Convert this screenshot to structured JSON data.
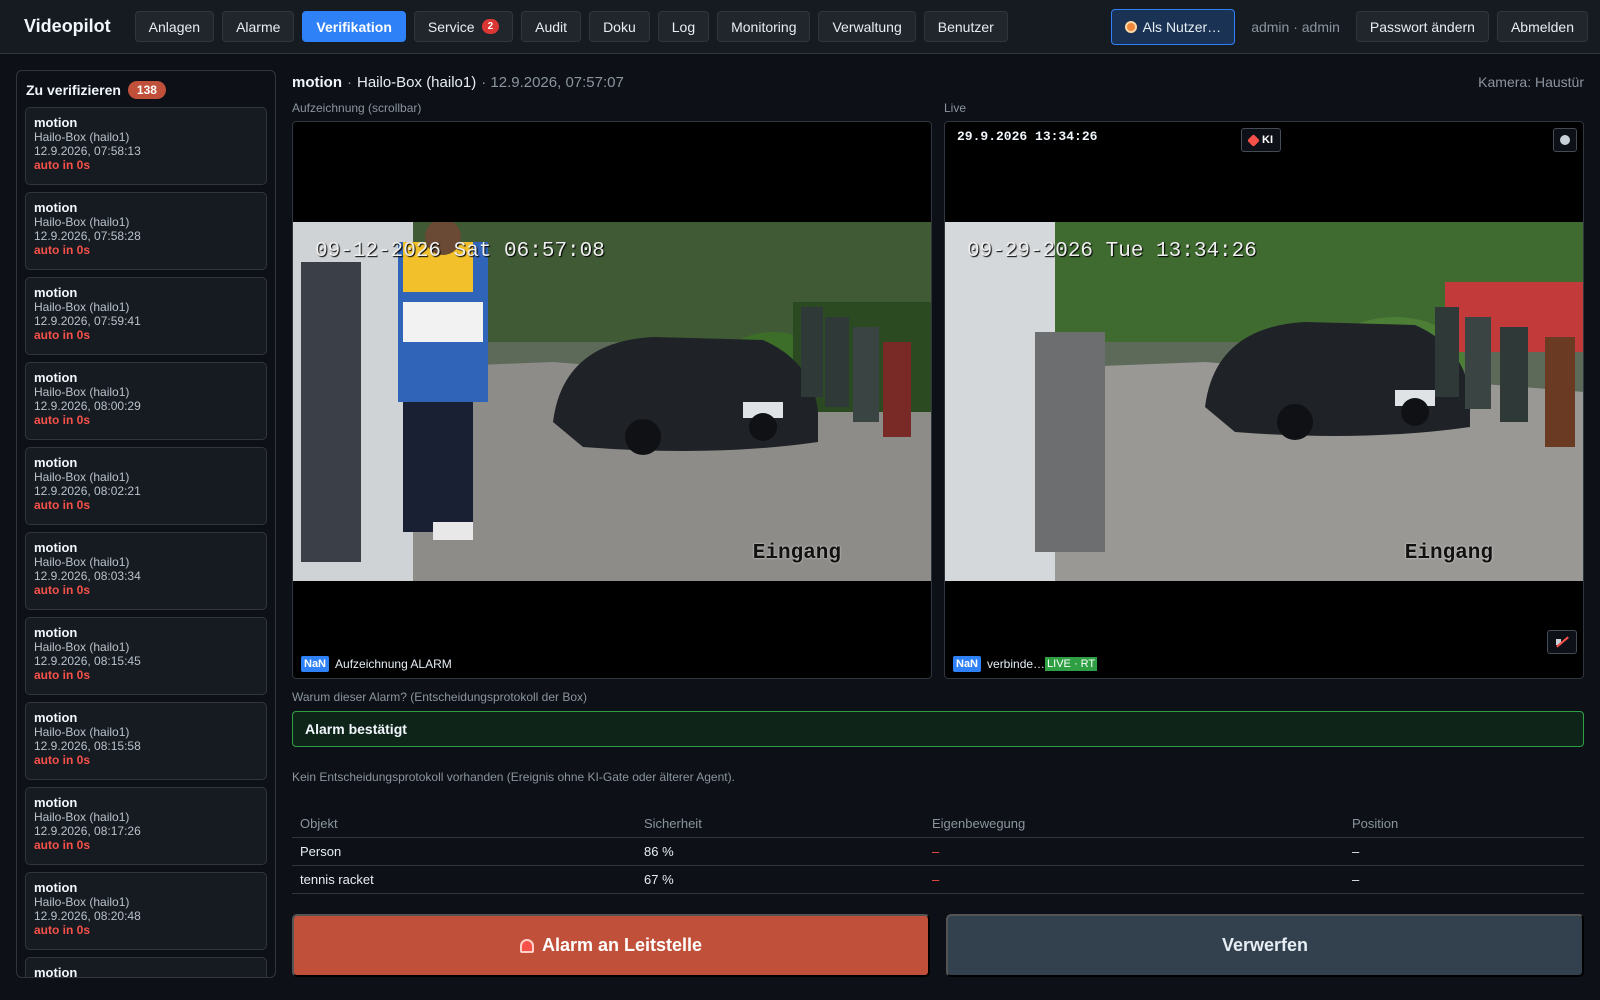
{
  "app": {
    "brand": "Videopilot"
  },
  "nav": {
    "items": [
      {
        "label": "Anlagen"
      },
      {
        "label": "Alarme"
      },
      {
        "label": "Verifikation",
        "active": true
      },
      {
        "label": "Service",
        "badge": "2"
      },
      {
        "label": "Audit"
      },
      {
        "label": "Doku"
      },
      {
        "label": "Log"
      },
      {
        "label": "Monitoring"
      },
      {
        "label": "Verwaltung"
      },
      {
        "label": "Benutzer"
      }
    ],
    "as_user": "Als Nutzer…",
    "user": "admin · admin",
    "change_password": "Passwort ändern",
    "logout": "Abmelden"
  },
  "queue": {
    "title": "Zu verifizieren",
    "count": "138",
    "items": [
      {
        "type": "motion",
        "source": "Hailo-Box (hailo1)",
        "time": "12.9.2026, 07:58:13",
        "auto": "auto in 0s"
      },
      {
        "type": "motion",
        "source": "Hailo-Box (hailo1)",
        "time": "12.9.2026, 07:58:28",
        "auto": "auto in 0s"
      },
      {
        "type": "motion",
        "source": "Hailo-Box (hailo1)",
        "time": "12.9.2026, 07:59:41",
        "auto": "auto in 0s"
      },
      {
        "type": "motion",
        "source": "Hailo-Box (hailo1)",
        "time": "12.9.2026, 08:00:29",
        "auto": "auto in 0s"
      },
      {
        "type": "motion",
        "source": "Hailo-Box (hailo1)",
        "time": "12.9.2026, 08:02:21",
        "auto": "auto in 0s"
      },
      {
        "type": "motion",
        "source": "Hailo-Box (hailo1)",
        "time": "12.9.2026, 08:03:34",
        "auto": "auto in 0s"
      },
      {
        "type": "motion",
        "source": "Hailo-Box (hailo1)",
        "time": "12.9.2026, 08:15:45",
        "auto": "auto in 0s"
      },
      {
        "type": "motion",
        "source": "Hailo-Box (hailo1)",
        "time": "12.9.2026, 08:15:58",
        "auto": "auto in 0s"
      },
      {
        "type": "motion",
        "source": "Hailo-Box (hailo1)",
        "time": "12.9.2026, 08:17:26",
        "auto": "auto in 0s"
      },
      {
        "type": "motion",
        "source": "Hailo-Box (hailo1)",
        "time": "12.9.2026, 08:20:48",
        "auto": "auto in 0s"
      },
      {
        "type": "motion",
        "source": "",
        "time": "",
        "auto": ""
      }
    ]
  },
  "event": {
    "type": "motion",
    "sep": "·",
    "source": "Hailo-Box (hailo1)",
    "time": "· 12.9.2026, 07:57:07",
    "camera": "Kamera: Haustür"
  },
  "recording": {
    "label": "Aufzeichnung (scrollbar)",
    "osd_date": "09-12-2026 Sat 06:57:08",
    "osd_location": "Eingang",
    "nan": "NaN",
    "status": "Aufzeichnung ALARM"
  },
  "live": {
    "label": "Live",
    "clock": "29.9.2026 13:34:26",
    "ki_label": "KI",
    "osd_date": "09-29-2026 Tue 13:34:26",
    "osd_location": "Eingang",
    "nan": "NaN",
    "status": "verbinde…",
    "live_badge": "LIVE · RT"
  },
  "decision": {
    "question": "Warum dieser Alarm? (Entscheidungsprotokoll der Box)",
    "result": "Alarm bestätigt",
    "note": "Kein Entscheidungsprotokoll vorhanden (Ereignis ohne KI-Gate oder älterer Agent)."
  },
  "objects": {
    "headers": [
      "Objekt",
      "Sicherheit",
      "Eigenbewegung",
      "Position"
    ],
    "rows": [
      [
        "Person",
        "86 %",
        "–",
        "–"
      ],
      [
        "tennis racket",
        "67 %",
        "–",
        "–"
      ]
    ]
  },
  "actions": {
    "alarm": "Alarm an Leitstelle",
    "discard": "Verwerfen"
  },
  "colors": {
    "accent": "#2f81f7",
    "alarm": "#c0503a",
    "confirm_border": "#2ea043",
    "live": "#2ea043"
  }
}
